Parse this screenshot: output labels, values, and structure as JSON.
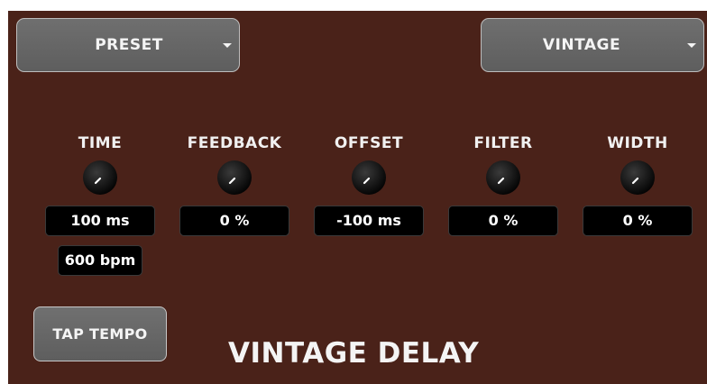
{
  "header": {
    "preset_dropdown": {
      "label": "PRESET"
    },
    "mode_dropdown": {
      "label": "VINTAGE"
    }
  },
  "controls": [
    {
      "id": "time",
      "label": "TIME",
      "value": "100 ms",
      "secondary_value": "600 bpm"
    },
    {
      "id": "feedback",
      "label": "FEEDBACK",
      "value": "0 %"
    },
    {
      "id": "offset",
      "label": "OFFSET",
      "value": "-100 ms"
    },
    {
      "id": "filter",
      "label": "FILTER",
      "value": "0 %"
    },
    {
      "id": "width",
      "label": "WIDTH",
      "value": "0 %"
    }
  ],
  "tap_tempo": {
    "label": "TAP TEMPO"
  },
  "plugin_title": "VINTAGE DELAY",
  "icons": {
    "dropdown": "chevron-down-icon",
    "knob": "knob-icon"
  },
  "colors": {
    "panel_background": "#4a2219",
    "button_face": "#666666",
    "value_box": "#000000",
    "text": "#f4f4f4"
  }
}
